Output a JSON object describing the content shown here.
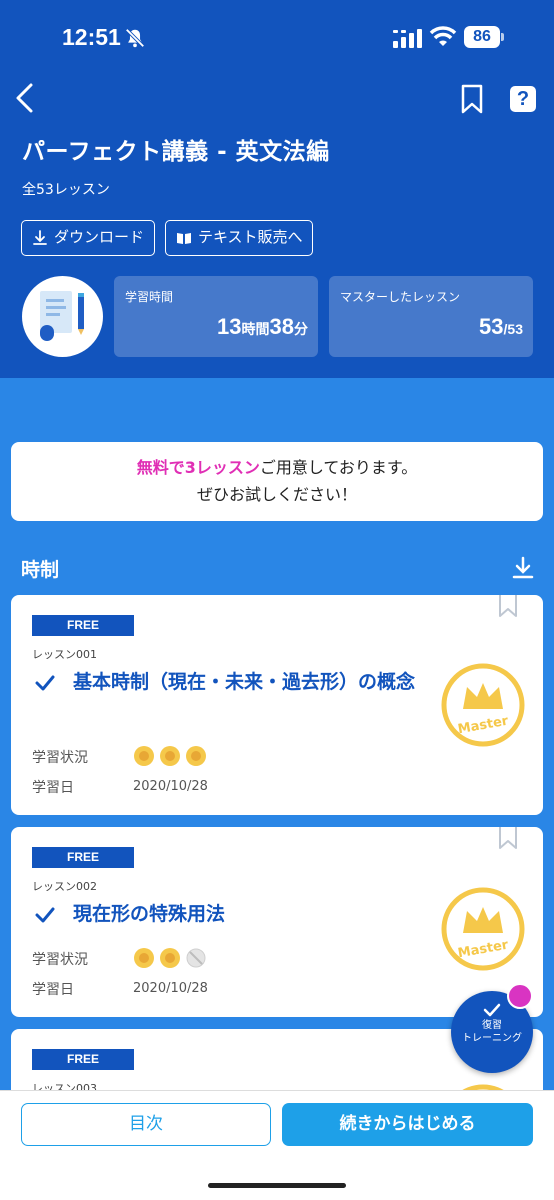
{
  "status_bar": {
    "time": "12:51",
    "battery": "86"
  },
  "header": {
    "title": "パーフェクト講義 - 英文法編",
    "lesson_count": "全53レッスン",
    "download_label": "ダウンロード",
    "text_sale_label": "テキスト販売へ",
    "help_label": "?",
    "stats": {
      "study_time_label": "学習時間",
      "study_hours": "13",
      "hours_unit": "時間",
      "study_minutes": "38",
      "minutes_unit": "分",
      "mastered_label": "マスターしたレッスン",
      "mastered": "53",
      "mastered_total": "/53"
    }
  },
  "notice": {
    "highlight": "無料で3レッスン",
    "line1_rest": "ご用意しております。",
    "line2": "ぜひお試しください！"
  },
  "section": {
    "title": "時制"
  },
  "lessons": [
    {
      "tag": "FREE",
      "number": "レッスン001",
      "title": "基本時制（現在・未来・過去形）の概念",
      "status_label": "学習状況",
      "date_label": "学習日",
      "date": "2020/10/28",
      "stars_filled": 3,
      "stars_total": 3,
      "badge": "Master"
    },
    {
      "tag": "FREE",
      "number": "レッスン002",
      "title": "現在形の特殊用法",
      "status_label": "学習状況",
      "date_label": "学習日",
      "date": "2020/10/28",
      "stars_filled": 2,
      "stars_total": 3,
      "badge": "Master"
    },
    {
      "tag": "FREE",
      "number": "レッスン003"
    }
  ],
  "fab": {
    "line1": "復習",
    "line2": "トレーニング"
  },
  "bottom": {
    "toc_label": "目次",
    "continue_label": "続きからはじめる"
  },
  "colors": {
    "header_bg": "#1254bd",
    "body_bg": "#2a86e6",
    "accent": "#1ea0e8",
    "pink": "#e02fb5",
    "gold": "#f5c84a"
  }
}
